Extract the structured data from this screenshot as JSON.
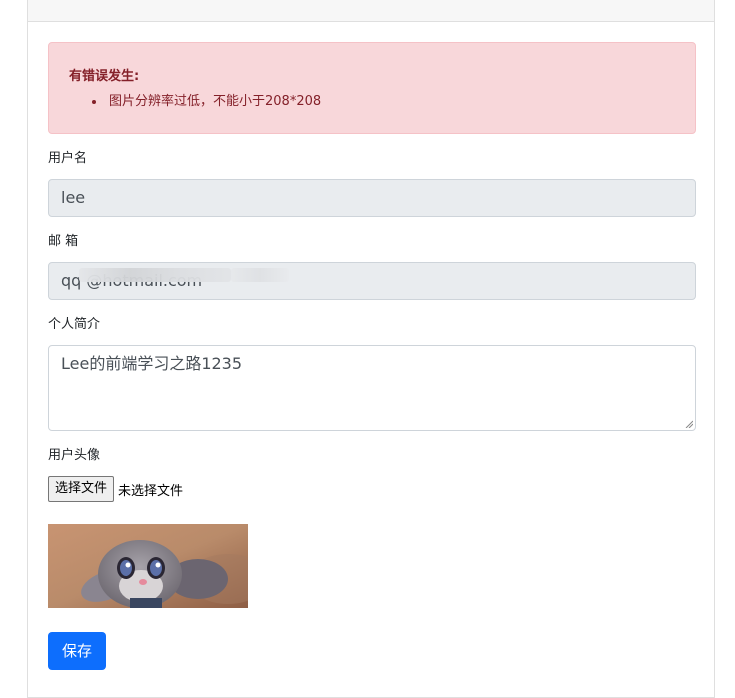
{
  "alert": {
    "title": "有错误发生:",
    "errors": [
      "图片分辨率过低，不能小于208*208"
    ]
  },
  "form": {
    "username": {
      "label": "用户名",
      "value": "lee"
    },
    "email": {
      "label": "邮 箱",
      "value": "qq            @hotmail.com"
    },
    "bio": {
      "label": "个人简介",
      "value": "Lee的前端学习之路1235"
    },
    "avatar": {
      "label": "用户头像",
      "file_button_label": "选择文件",
      "file_status": "未选择文件"
    },
    "save_label": "保存"
  },
  "colors": {
    "alert_bg": "#f8d7da",
    "alert_text": "#842029",
    "readonly_bg": "#e9ecef",
    "primary": "#0d6efd"
  }
}
